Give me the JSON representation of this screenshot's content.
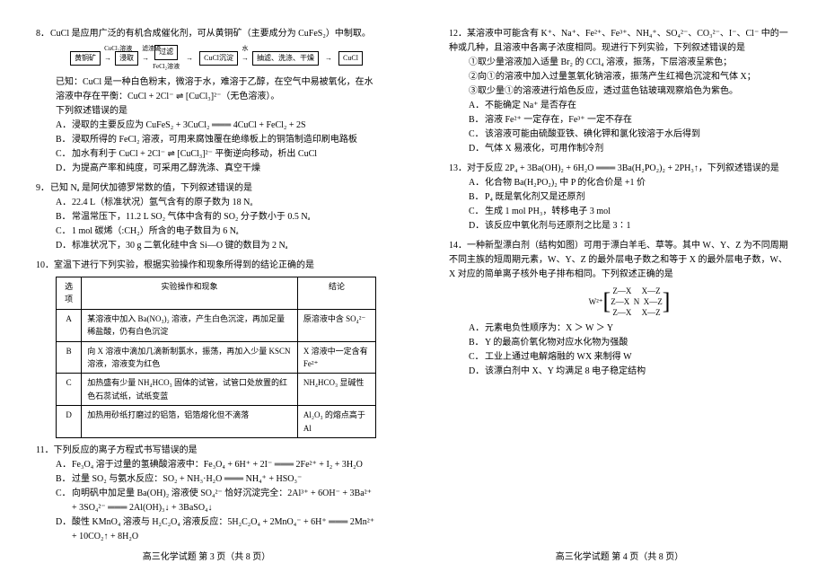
{
  "left": {
    "q8": {
      "stem": "CuCl 是应用广泛的有机合成催化剂，可从黄铜矿（主要成分为 CuFeS₂）中制取。",
      "flow": {
        "n1": "黄铜矿",
        "t1": "CuCl₂溶液",
        "n2": "浸取",
        "t2": "滤渣硫",
        "n3": "过滤",
        "t3": "FeCl₂溶液",
        "n4": "CuCl沉淀",
        "t4": "水",
        "n5": "抽滤、洗涤、干燥",
        "n6": "CuCl"
      },
      "info1": "已知：CuCl 是一种白色粉末，微溶于水，难溶于乙醇，在空气中易被氧化，在水溶液中存在平衡：CuCl + 2Cl⁻ ⇌ [CuCl₃]²⁻（无色溶液）。",
      "info2": "下列叙述错误的是",
      "A": "浸取的主要反应为 CuFeS₂ + 3CuCl₂ ═══ 4CuCl + FeCl₂ + 2S",
      "B": "浸取所得的 FeCl₂ 溶液，可用来腐蚀覆在绝缘板上的铜箔制造印刷电路板",
      "C": "加水有利于 CuCl + 2Cl⁻ ⇌ [CuCl₃]²⁻ 平衡逆向移动，析出 CuCl",
      "D": "为提高产率和纯度，可采用乙醇洗涤、真空干燥"
    },
    "q9": {
      "stem": "已知 Nₐ 是阿伏加德罗常数的值，下列叙述错误的是",
      "A": "22.4 L（标准状况）氩气含有的原子数为 18 Nₐ",
      "B": "常温常压下，11.2 L SO₂ 气体中含有的 SO₂ 分子数小于 0.5 Nₐ",
      "C": "1 mol 碳烯（:CH₂）所含的电子数目为 6 Nₐ",
      "D": "标准状况下，30 g 二氧化硅中含 Si—O 键的数目为 2 Nₐ"
    },
    "q10": {
      "stem": "室温下进行下列实验，根据实验操作和现象所得到的结论正确的是",
      "headers": [
        "选项",
        "实验操作和现象",
        "结论"
      ],
      "rows": [
        [
          "A",
          "某溶液中加入 Ba(NO₃)₂ 溶液，产生白色沉淀，再加足量稀盐酸，仍有白色沉淀",
          "原溶液中含 SO₄²⁻"
        ],
        [
          "B",
          "向 X 溶液中滴加几滴新制氯水，振荡，再加入少量 KSCN 溶液，溶液变为红色",
          "X 溶液中一定含有 Fe²⁺"
        ],
        [
          "C",
          "加热盛有少量 NH₄HCO₃ 固体的试管，试管口处放置的红色石蕊试纸，试纸变蓝",
          "NH₄HCO₃ 显碱性"
        ],
        [
          "D",
          "加热用砂纸打磨过的铝箔，铝箔熔化但不滴落",
          "Al₂O₃ 的熔点高于 Al"
        ]
      ]
    },
    "q11": {
      "stem": "下列反应的离子方程式书写错误的是",
      "A": "Fe₃O₄ 溶于过量的氢碘酸溶液中：Fe₃O₄ + 6H⁺ + 2I⁻ ═══ 2Fe²⁺ + I₂ + 3H₂O",
      "B": "过量 SO₂ 与氨水反应：SO₂ + NH₃·H₂O ═══ NH₄⁺ + HSO₃⁻",
      "C": "向明矾中加足量 Ba(OH)₂ 溶液使 SO₄²⁻ 恰好沉淀完全：2Al³⁺ + 6OH⁻ + 3Ba²⁺ + 3SO₄²⁻ ═══ 2Al(OH)₃↓ + 3BaSO₄↓",
      "D": "酸性 KMnO₄ 溶液与 H₂C₂O₄ 溶液反应：5H₂C₂O₄ + 2MnO₄⁻ + 6H⁺ ═══ 2Mn²⁺ + 10CO₂↑ + 8H₂O"
    },
    "footer": "高三化学试题 第 3 页（共 8 页）"
  },
  "right": {
    "q12": {
      "stem": "某溶液中可能含有 K⁺、Na⁺、Fe²⁺、Fe³⁺、NH₄⁺、SO₄²⁻、CO₃²⁻、I⁻、Cl⁻ 中的一种或几种，且溶液中各离子浓度相同。现进行下列实验，下列叙述错误的是",
      "s1": "①取少量溶液加入适量 Br₂ 的 CCl₄ 溶液，振荡，下层溶液呈紫色；",
      "s2": "②向①的溶液中加入过量氢氧化钠溶液，振荡产生红褐色沉淀和气体 X；",
      "s3": "③取少量①的溶液进行焰色反应，透过蓝色钴玻璃观察焰色为紫色。",
      "A": "不能确定 Na⁺ 是否存在",
      "B": "溶液 Fe²⁺ 一定存在，Fe³⁺ 一定不存在",
      "C": "该溶液可能由硫酸亚铁、碘化钾和氯化铵溶于水后得到",
      "D": "气体 X 易液化，可用作制冷剂"
    },
    "q13": {
      "stem": "对于反应 2P₄ + 3Ba(OH)₂ + 6H₂O ═══ 3Ba(H₂PO₂)₂ + 2PH₃↑，下列叙述错误的是",
      "A": "化合物 Ba(H₂PO₂)₂ 中 P 的化合价是 +1 价",
      "B": "P₄ 既是氧化剂又是还原剂",
      "C": "生成 1 mol PH₃，转移电子 3 mol",
      "D": "该反应中氧化剂与还原剂之比是 3∶1"
    },
    "q14": {
      "stem1": "一种新型漂白剂（结构如图）可用于漂白羊毛、草等。其中 W、Y、Z 为不同周期不同主族的短周期元素，W、Y、Z 的最外层电子数之和等于 X 的最外层电子数，W、X 对应的简单离子核外电子排布相同。下列叙述正确的是",
      "structLabel": "W²⁺",
      "structRow1": "Z—X     X—Z",
      "structRow2": "Z—X  N  X—Z",
      "structRow3": "Z—X     X—Z",
      "A": "元素电负性顺序为：X ＞ W ＞ Y",
      "B": "Y 的最高价氧化物对应水化物为强酸",
      "C": "工业上通过电解熔融的 WX 来制得 W",
      "D": "该漂白剂中 X、Y 均满足 8 电子稳定结构"
    },
    "footer": "高三化学试题 第 4 页（共 8 页）"
  }
}
